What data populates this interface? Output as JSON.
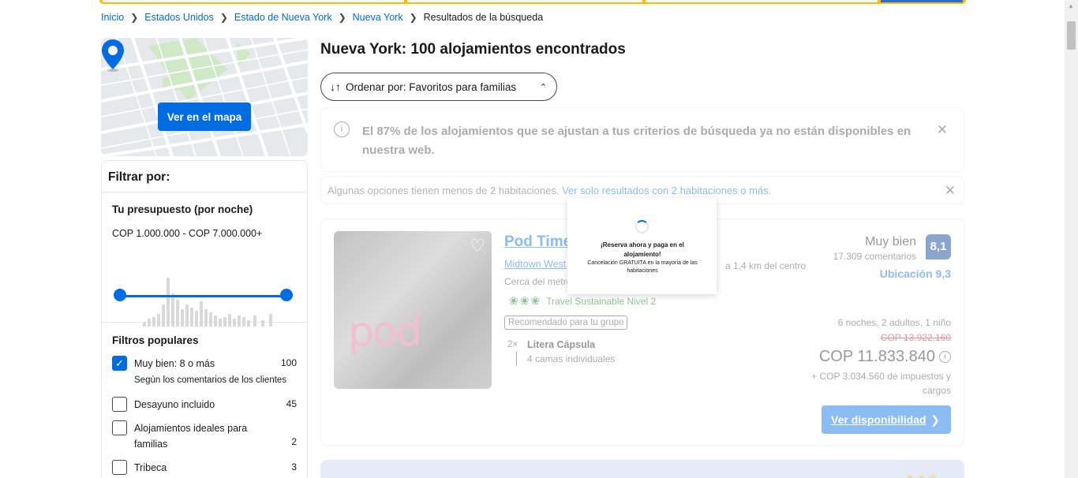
{
  "colors": {
    "brand_blue": "#006ce4",
    "top_bar_yellow": "#febb02",
    "score_badge": "#003b95",
    "eco_green": "#008009",
    "strike_red": "#d4111e"
  },
  "breadcrumb": [
    {
      "label": "Inicio"
    },
    {
      "label": "Estados Unidos"
    },
    {
      "label": "Estado de Nueva York"
    },
    {
      "label": "Nueva York"
    },
    {
      "label": "Resultados de la búsqueda"
    }
  ],
  "map": {
    "button_label": "Ver en el mapa"
  },
  "filters": {
    "heading": "Filtrar por:",
    "budget": {
      "title": "Tu presupuesto (por noche)",
      "range": "COP 1.000.000 - COP 7.000.000+"
    },
    "popular": {
      "title": "Filtros populares",
      "items": [
        {
          "label": "Muy bien: 8 o más",
          "sublabel": "Según los comentarios de los clientes",
          "count": "100",
          "checked": true
        },
        {
          "label": "Desayuno incluido",
          "count": "45",
          "checked": false
        },
        {
          "label": "Alojamientos ideales para familias",
          "count": "2",
          "checked": false
        },
        {
          "label": "Tribeca",
          "count": "3",
          "checked": false
        }
      ]
    }
  },
  "results": {
    "title": "Nueva York: 100 alojamientos encontrados",
    "sort": {
      "icon": "sort-arrows-icon",
      "label": "Ordenar por: Favoritos para familias"
    },
    "info_message": "El 87% de los alojamientos que se ajustan a tus criterios de búsqueda ya no están disponibles en nuestra web.",
    "note": {
      "text": "Algunas opciones tienen menos de 2 habitaciones.",
      "link": "Ver solo resultados con 2 habitaciones o más."
    }
  },
  "hotel": {
    "name": "Pod Time",
    "location": "Midtown West",
    "distance": "a 1,4 km del centro",
    "near": "Cerca del metro",
    "sustainable": "Travel Sustainable Nivel 2",
    "recommended": "Recomendado para tu grupo",
    "room_qty": "2×",
    "room_name": "Litera Cápsula",
    "room_beds": "4 camas individuales",
    "score_word": "Muy bien",
    "review_count": "17.309 comentarios",
    "score": "8,1",
    "location_score": "Ubicación 9,3",
    "stay_info": "6 noches, 2 adultos, 1 niño",
    "old_price": "COP 13.922.160",
    "price": "COP 11.833.840",
    "taxes": "+ COP 3.034.560 de impuestos y cargos",
    "cta": "Ver disponibilidad",
    "photo_text": "pod"
  },
  "popup": {
    "title": "¡Reserva ahora y paga en el alojamiento!",
    "subtitle": "Cancelación GRATUITA en la mayoría de las habitaciones"
  }
}
